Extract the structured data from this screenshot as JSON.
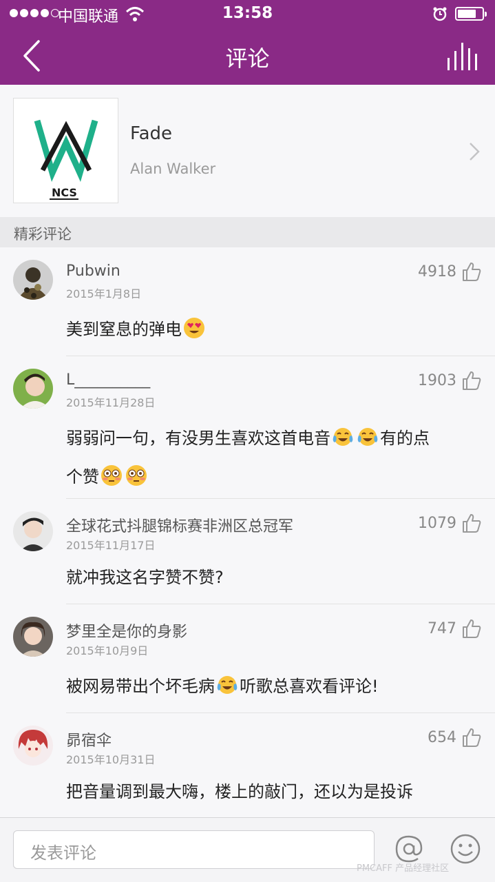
{
  "status_bar": {
    "carrier": "中国联通",
    "time": "13:58",
    "battery_level": 0.75
  },
  "nav": {
    "title": "评论"
  },
  "song": {
    "title": "Fade",
    "artist": "Alan Walker",
    "cover_text": "NCS"
  },
  "section": {
    "label": "精彩评论"
  },
  "comments": [
    {
      "user": "Pubwin",
      "date": "2015年1月8日",
      "likes": "4918",
      "parts": [
        "美到窒息的弹电",
        ""
      ]
    },
    {
      "user": "L__________",
      "date": "2015年11月28日",
      "likes": "1903",
      "parts": [
        "弱弱问一句，有没男生喜欢这首电音",
        "有的点",
        "个赞",
        ""
      ]
    },
    {
      "user": "全球花式抖腿锦标赛非洲区总冠军",
      "date": "2015年11月17日",
      "likes": "1079",
      "parts": [
        "就冲我这名字赞不赞?"
      ]
    },
    {
      "user": "梦里全是你的身影",
      "date": "2015年10月9日",
      "likes": "747",
      "parts": [
        "被网易带出个坏毛病",
        "听歌总喜欢看评论!"
      ]
    },
    {
      "user": "昴宿伞",
      "date": "2015年10月31日",
      "likes": "654",
      "parts": [
        "把音量调到最大嗨，楼上的敲门，还以为是投诉"
      ]
    }
  ],
  "bottom": {
    "input_placeholder": "发表评论",
    "watermark": "PMCAFF 产品经理社区"
  },
  "colors": {
    "brand": "#8a2a86",
    "logo_green": "#1fb08a"
  },
  "icons": [
    "back-icon",
    "equalizer-icon",
    "chevron-right-icon",
    "thumbs-up-icon",
    "at-icon",
    "smiley-icon",
    "wifi-icon",
    "alarm-icon"
  ]
}
